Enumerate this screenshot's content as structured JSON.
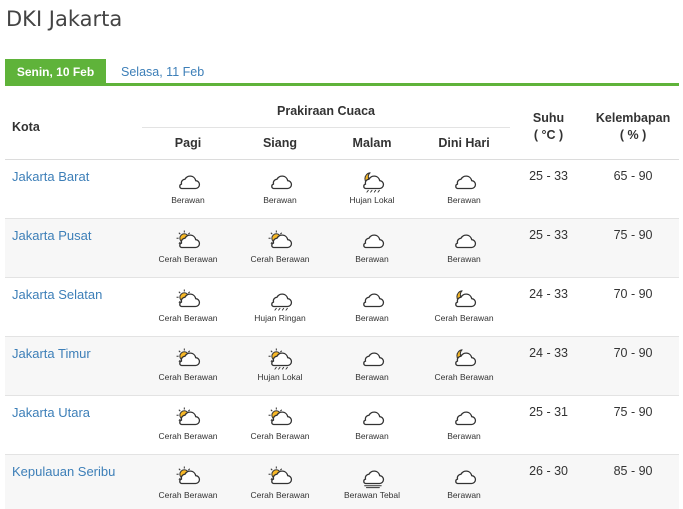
{
  "page": {
    "title": "DKI Jakarta"
  },
  "tabs": [
    {
      "label": "Senin, 10 Feb",
      "active": true
    },
    {
      "label": "Selasa, 11 Feb",
      "active": false
    }
  ],
  "colors": {
    "accent": "#5fb33a",
    "link": "#3d7fb8",
    "sun": "#f7b827"
  },
  "table": {
    "col_kota": "Kota",
    "group_label": "Prakiraan Cuaca",
    "periods": [
      "Pagi",
      "Siang",
      "Malam",
      "Dini Hari"
    ],
    "col_suhu_line1": "Suhu",
    "col_suhu_line2": "( °C )",
    "col_lembap_line1": "Kelembapan",
    "col_lembap_line2": "( % )",
    "rows": [
      {
        "city": "Jakarta Barat",
        "forecast": [
          {
            "label": "Berawan",
            "icon": "cloudy-icon"
          },
          {
            "label": "Berawan",
            "icon": "cloudy-icon"
          },
          {
            "label": "Hujan Lokal",
            "icon": "moon-cloud-rain-icon"
          },
          {
            "label": "Berawan",
            "icon": "cloudy-icon"
          }
        ],
        "suhu": "25 - 33",
        "kelembapan": "65 - 90"
      },
      {
        "city": "Jakarta Pusat",
        "forecast": [
          {
            "label": "Cerah Berawan",
            "icon": "sun-cloud-icon"
          },
          {
            "label": "Cerah Berawan",
            "icon": "sun-cloud-icon"
          },
          {
            "label": "Berawan",
            "icon": "cloudy-icon"
          },
          {
            "label": "Berawan",
            "icon": "cloudy-icon"
          }
        ],
        "suhu": "25 - 33",
        "kelembapan": "75 - 90"
      },
      {
        "city": "Jakarta Selatan",
        "forecast": [
          {
            "label": "Cerah Berawan",
            "icon": "sun-cloud-icon"
          },
          {
            "label": "Hujan Ringan",
            "icon": "cloud-rain-icon"
          },
          {
            "label": "Berawan",
            "icon": "cloudy-icon"
          },
          {
            "label": "Cerah Berawan",
            "icon": "moon-cloud-icon"
          }
        ],
        "suhu": "24 - 33",
        "kelembapan": "70 - 90"
      },
      {
        "city": "Jakarta Timur",
        "forecast": [
          {
            "label": "Cerah Berawan",
            "icon": "sun-cloud-icon"
          },
          {
            "label": "Hujan Lokal",
            "icon": "sun-cloud-rain-icon"
          },
          {
            "label": "Berawan",
            "icon": "cloudy-icon"
          },
          {
            "label": "Cerah Berawan",
            "icon": "moon-cloud-icon"
          }
        ],
        "suhu": "24 - 33",
        "kelembapan": "70 - 90"
      },
      {
        "city": "Jakarta Utara",
        "forecast": [
          {
            "label": "Cerah Berawan",
            "icon": "sun-cloud-icon"
          },
          {
            "label": "Cerah Berawan",
            "icon": "sun-cloud-icon"
          },
          {
            "label": "Berawan",
            "icon": "cloudy-icon"
          },
          {
            "label": "Berawan",
            "icon": "cloudy-icon"
          }
        ],
        "suhu": "25 - 31",
        "kelembapan": "75 - 90"
      },
      {
        "city": "Kepulauan Seribu",
        "forecast": [
          {
            "label": "Cerah Berawan",
            "icon": "sun-cloud-icon"
          },
          {
            "label": "Cerah Berawan",
            "icon": "sun-cloud-icon"
          },
          {
            "label": "Berawan Tebal",
            "icon": "overcast-icon"
          },
          {
            "label": "Berawan",
            "icon": "cloudy-icon"
          }
        ],
        "suhu": "26 - 30",
        "kelembapan": "85 - 90"
      }
    ]
  }
}
